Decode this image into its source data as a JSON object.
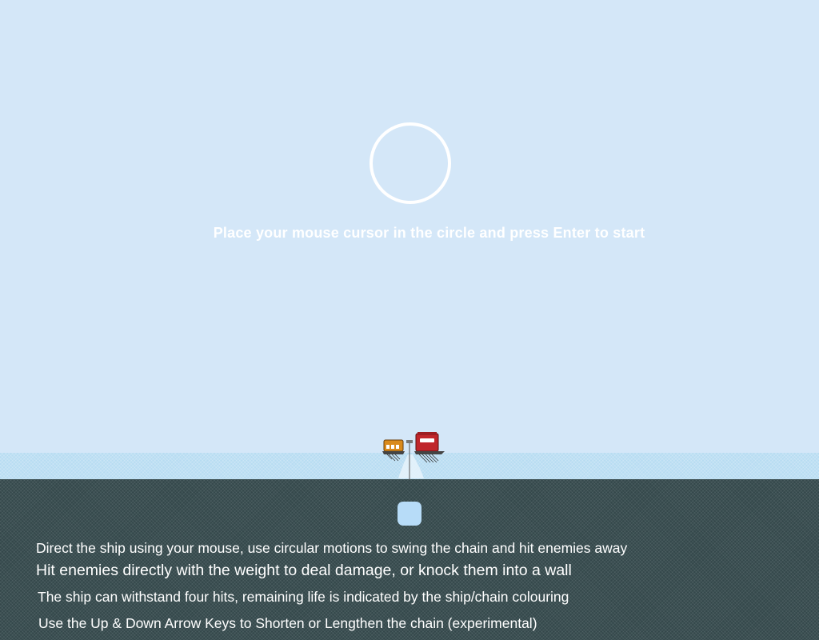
{
  "start_screen": {
    "prompt": "Place your mouse cursor in the circle and press Enter to start"
  },
  "instructions": [
    "Direct the ship using your mouse, use circular motions to swing the chain and  hit enemies away",
    "Hit enemies directly with the weight to deal damage, or knock them into a wall",
    "The ship can withstand four hits, remaining life is indicated by the ship/chain colouring",
    "Use the Up & Down Arrow Keys to Shorten or Lengthen the chain (experimental)"
  ],
  "colors": {
    "sky": "#d4e7f8",
    "water": "#b7dcf2",
    "ground": "#34484b",
    "text": "#ffffff",
    "ship_left_cabin": "#d98a1c",
    "ship_right_cabin": "#c0262b",
    "weight": "#b7dcf8"
  },
  "icons": {
    "start_target": "circle-outline",
    "player": "ship-icon",
    "chain_weight": "weight-icon"
  }
}
